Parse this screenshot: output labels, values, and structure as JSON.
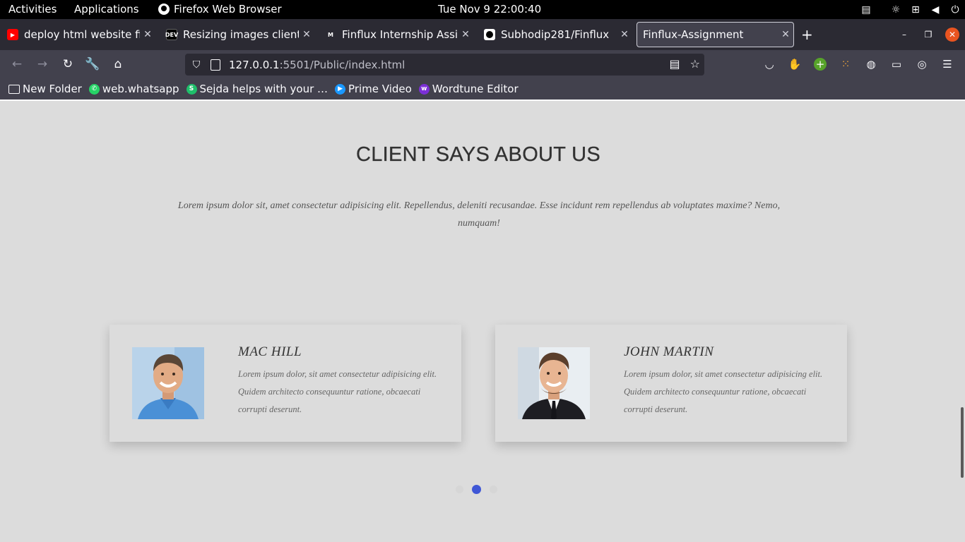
{
  "topbar": {
    "activities": "Activities",
    "applications": "Applications",
    "app_name": "Firefox Web Browser",
    "clock": "Tue Nov 9  22:00:40"
  },
  "tabs": [
    {
      "title": "deploy html website firel",
      "icon": "youtube-icon"
    },
    {
      "title": "Resizing images client-sic",
      "icon": "dev-icon"
    },
    {
      "title": "Finflux Internship Assign",
      "icon": "gmail-icon"
    },
    {
      "title": "Subhodip281/Finflux",
      "icon": "github-icon"
    },
    {
      "title": "Finflux-Assignment",
      "icon": "none",
      "active": true
    }
  ],
  "urlbar": {
    "host": "127.0.0.1",
    "path": ":5501/Public/index.html"
  },
  "bookmarks": [
    {
      "label": "New Folder",
      "icon": "folder-icon"
    },
    {
      "label": "web.whatsapp",
      "icon": "whatsapp-icon"
    },
    {
      "label": "Sejda helps with your …",
      "icon": "sejda-icon"
    },
    {
      "label": "Prime Video",
      "icon": "prime-video-icon"
    },
    {
      "label": "Wordtune Editor",
      "icon": "wordtune-icon"
    }
  ],
  "section": {
    "title": "CLIENT SAYS ABOUT US",
    "intro": "Lorem ipsum dolor sit, amet consectetur adipisicing elit. Repellendus, deleniti recusandae. Esse incidunt rem repellendus ab voluptates maxime? Nemo, numquam!"
  },
  "testimonials": [
    {
      "name": "MAC HILL",
      "text": "Lorem ipsum dolor, sit amet consectetur adipisicing elit. Quidem architecto consequuntur ratione, obcaecati corrupti deserunt."
    },
    {
      "name": "JOHN MARTIN",
      "text": "Lorem ipsum dolor, sit amet consectetur adipisicing elit. Quidem architecto consequuntur ratione, obcaecati corrupti deserunt."
    }
  ],
  "carousel": {
    "active_index": 1,
    "count": 3
  },
  "colors": {
    "accent": "#3f57d6",
    "page_bg": "#dcdcdc",
    "tab_bg": "#2b2a33",
    "toolbar_bg": "#42414d"
  }
}
